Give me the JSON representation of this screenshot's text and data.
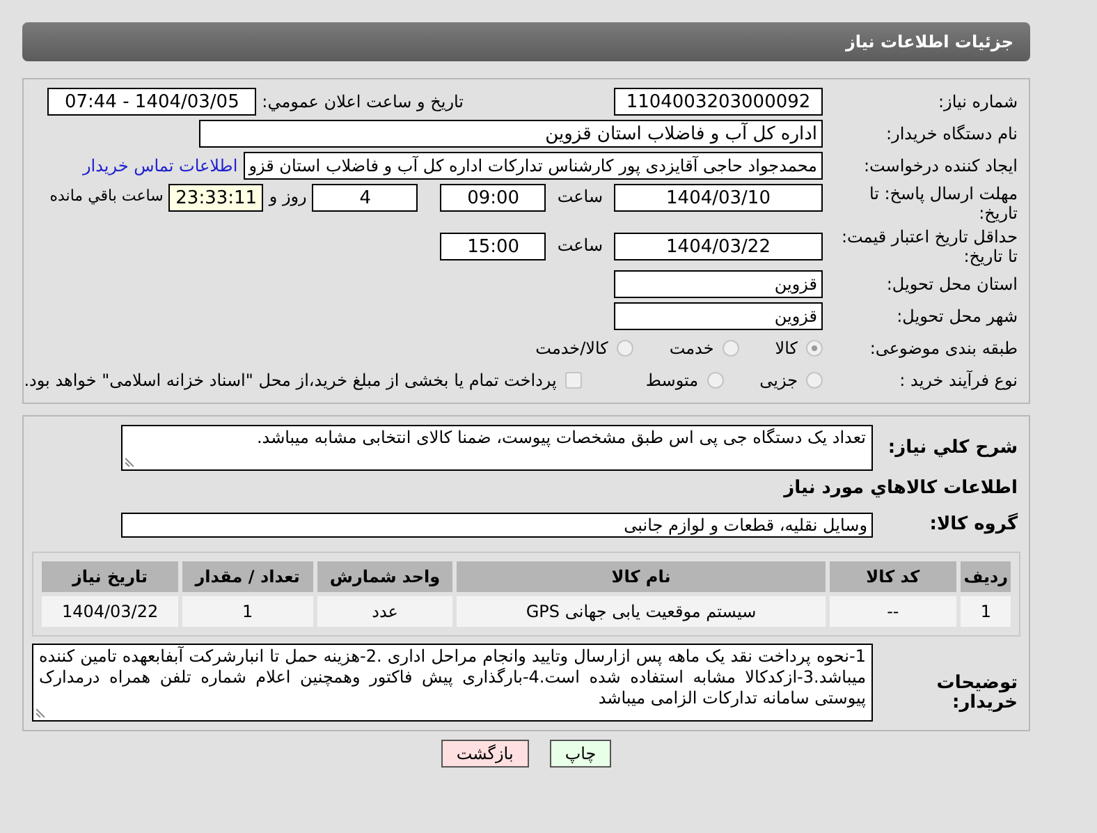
{
  "header": {
    "title": "جزئیات اطلاعات نیاز"
  },
  "details": {
    "need_number": {
      "label": "شماره نیاز:",
      "value": "1104003203000092"
    },
    "announcement": {
      "label": "تاریخ و ساعت اعلان عمومي:",
      "value": "1404/03/05 - 07:44"
    },
    "buyer_org": {
      "label": "نام دستگاه خریدار:",
      "value": "اداره کل آب و فاضلاب استان قزوین"
    },
    "requester": {
      "label": "ایجاد کننده درخواست:",
      "value": "محمدجواد حاجی آقایزدی پور کارشناس تدارکات اداره کل آب و فاضلاب استان قزو",
      "link": "اطلاعات تماس خریدار"
    },
    "response_deadline": {
      "label": "مهلت ارسال پاسخ: تا تاریخ:",
      "date": "1404/03/10",
      "time_label": "ساعت",
      "time": "09:00",
      "days": "4",
      "days_label": "روز و",
      "remaining": "23:33:11",
      "remaining_label": "ساعت باقي مانده"
    },
    "price_validity": {
      "label": "حداقل تاریخ اعتبار قیمت: تا تاریخ:",
      "date": "1404/03/22",
      "time_label": "ساعت",
      "time": "15:00"
    },
    "delivery_province": {
      "label": "استان محل تحویل:",
      "value": "قزوین"
    },
    "delivery_city": {
      "label": "شهر محل تحویل:",
      "value": "قزوین"
    },
    "category": {
      "label": "طبقه بندی موضوعی:",
      "options": [
        {
          "label": "کالا",
          "selected": true
        },
        {
          "label": "خدمت",
          "selected": false
        },
        {
          "label": "کالا/خدمت",
          "selected": false
        }
      ]
    },
    "purchase_type": {
      "label": "نوع فرآیند خرید :",
      "options": [
        {
          "label": "جزیی",
          "selected": false
        },
        {
          "label": "متوسط",
          "selected": false
        }
      ],
      "treasury": {
        "label": "پرداخت تمام یا بخشی از مبلغ خرید،از محل \"اسناد خزانه اسلامی\" خواهد بود.",
        "checked": false
      }
    }
  },
  "needs": {
    "summary": {
      "label": "شرح کلي نياز:",
      "value": "تعداد یک دستگاه جی پی اس طبق مشخصات پیوست، ضمنا کالای انتخابی مشابه میباشد."
    },
    "goods_title": "اطلاعات کالاهاي مورد نياز",
    "goods_group": {
      "label": "گروه کالا:",
      "value": "وسایل نقلیه، قطعات و لوازم جانبی"
    },
    "table": {
      "columns": [
        "ردیف",
        "کد کالا",
        "نام کالا",
        "واحد شمارش",
        "تعداد / مقدار",
        "تاریخ نیاز"
      ],
      "rows": [
        [
          "1",
          "--",
          "سیستم موقعیت یابی جهانی GPS",
          "عدد",
          "1",
          "1404/03/22"
        ]
      ]
    },
    "buyer_notes": {
      "label": "توضیحات خریدار:",
      "value": "1-نحوه پرداخت نقد یک ماهه پس ازارسال وتایید وانجام مراحل اداری .2-هزینه حمل تا انبارشرکت آبفابعهده تامین کننده میباشد.3-ازکدکالا مشابه استفاده شده است.4-بارگذاری پیش فاکتور وهمچنین اعلام شماره تلفن همراه درمدارک پیوستی سامانه تدارکات الزامی میباشد"
    }
  },
  "buttons": [
    {
      "label": "چاپ",
      "kind": "print"
    },
    {
      "label": "بازگشت",
      "kind": "back"
    }
  ]
}
